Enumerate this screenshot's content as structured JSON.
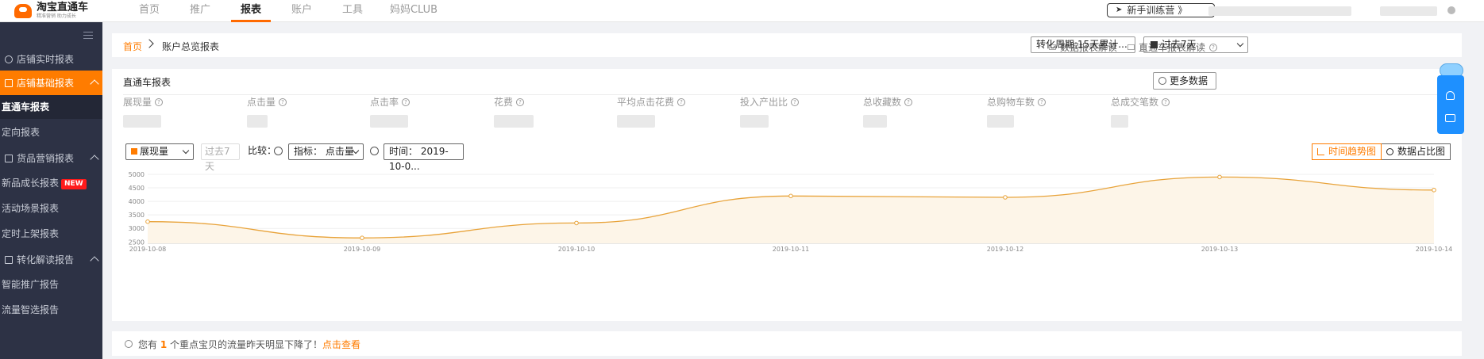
{
  "brand": {
    "title": "淘宝直通车",
    "subtitle": "精准营销 助力成长"
  },
  "nav": {
    "items": [
      "首页",
      "推广",
      "报表",
      "账户",
      "工具",
      "妈妈CLUB"
    ],
    "active": 2
  },
  "header": {
    "trainer_label": "新手训练营 》"
  },
  "sidebar": {
    "groups": [
      {
        "label": "店铺实时报表",
        "active": false
      },
      {
        "label": "店铺基础报表",
        "active": true
      },
      {
        "label": "货品营销报表",
        "active": false
      },
      {
        "label": "转化解读报告",
        "active": false
      }
    ],
    "items": [
      {
        "label": "直通车报表",
        "active": true
      },
      {
        "label": "定向报表"
      },
      {
        "label": "新品成长报表",
        "badge": "NEW"
      },
      {
        "label": "活动场景报表"
      },
      {
        "label": "定时上架报表"
      },
      {
        "label": "智能推广报告"
      },
      {
        "label": "流量智选报告"
      }
    ]
  },
  "breadcrumb": {
    "home": "首页",
    "current": "账户总览报表"
  },
  "toolbar": {
    "data_report_help": "数据报表解读",
    "ztc_report_help": "直通车报表解读",
    "conversion_period": "转化周期:15天累计...",
    "date_range": "过去7天"
  },
  "report": {
    "title": "直通车报表",
    "more_data": "更多数据",
    "metrics": [
      "展现量",
      "点击量",
      "点击率",
      "花费",
      "平均点击花费",
      "投入产出比",
      "总收藏数",
      "总购物车数",
      "总成交笔数"
    ],
    "controls": {
      "metric_select": "展现量",
      "period": "过去7天",
      "compare_label": "比较：",
      "indicator_select": "指标： 点击量",
      "time_select": "时间： 2019-10-0..."
    },
    "view_buttons": [
      "时间趋势图",
      "数据占比图"
    ]
  },
  "chart_data": {
    "type": "line",
    "x": [
      "2019-10-08",
      "2019-10-09",
      "2019-10-10",
      "2019-10-11",
      "2019-10-12",
      "2019-10-13",
      "2019-10-14"
    ],
    "series": [
      {
        "values": [
          3250,
          2650,
          3200,
          4200,
          4150,
          4900,
          4420
        ]
      }
    ],
    "yticks": [
      5000,
      4500,
      4000,
      3500,
      3000,
      2500
    ],
    "ylim": [
      2450,
      5000
    ],
    "color": "#e8a33a",
    "grid": true
  },
  "alert": {
    "prefix": "您有 ",
    "count": "1",
    "suffix": " 个重点宝贝的流量昨天明显下降了！",
    "link": "点击查看"
  }
}
